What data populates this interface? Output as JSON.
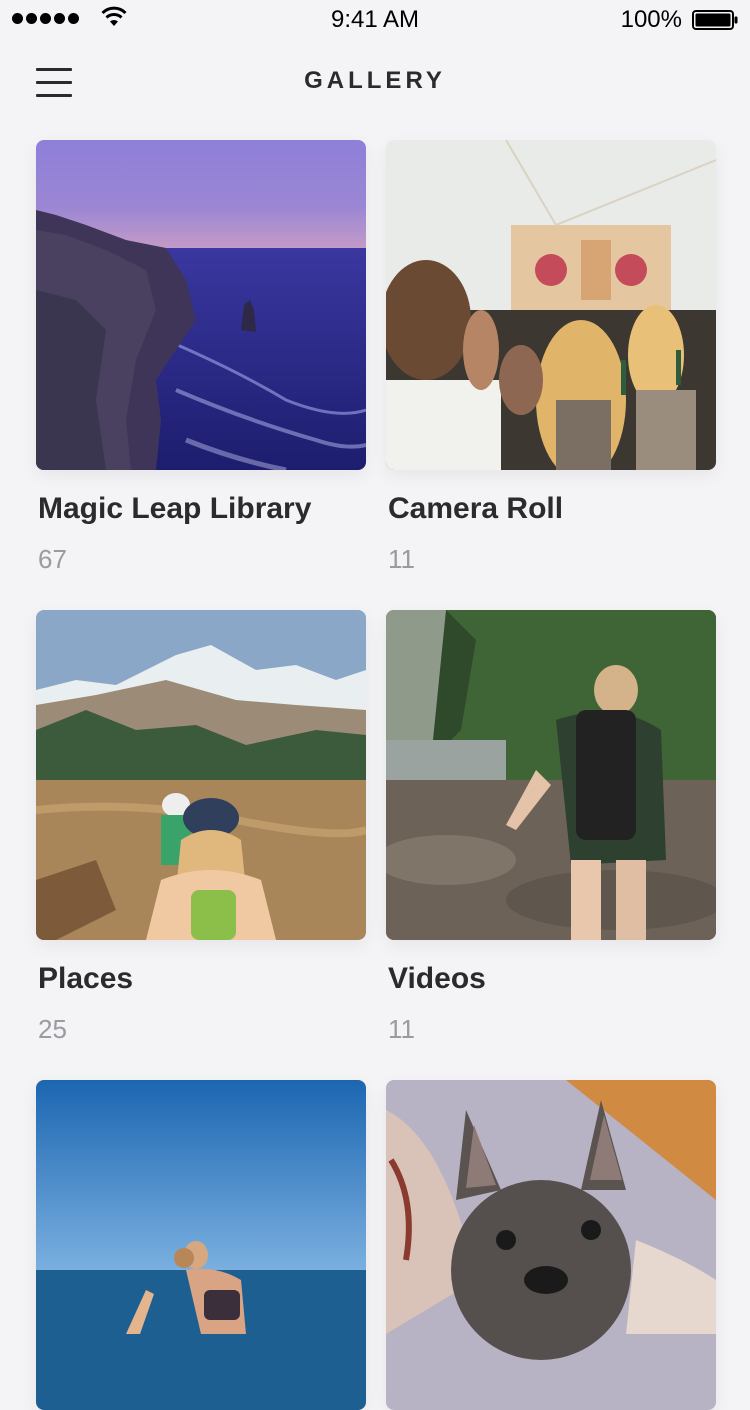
{
  "status_bar": {
    "time": "9:41 AM",
    "battery": "100%",
    "icons": [
      "signal-dots-icon",
      "wifi-icon",
      "battery-icon"
    ]
  },
  "nav": {
    "title": "GALLERY",
    "menu_icon": "hamburger-menu-icon"
  },
  "albums": [
    {
      "title": "Magic Leap Library",
      "count": "67",
      "image": "cliffs-ocean-at-dusk"
    },
    {
      "title": "Camera Roll",
      "count": "11",
      "image": "festival-crowd"
    },
    {
      "title": "Places",
      "count": "25",
      "image": "mountain-hikers"
    },
    {
      "title": "Videos",
      "count": "11",
      "image": "forest-hiker-with-backpack"
    },
    {
      "title": "",
      "count": "",
      "image": "woman-on-beach-blue-sky"
    },
    {
      "title": "",
      "count": "",
      "image": "french-bulldog"
    }
  ]
}
